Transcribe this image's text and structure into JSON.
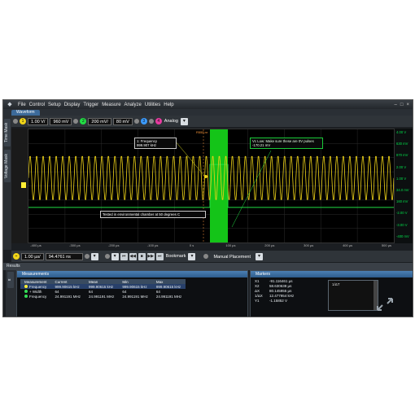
{
  "menu": [
    "File",
    "Control",
    "Setup",
    "Display",
    "Trigger",
    "Measure",
    "Analyze",
    "Utilities",
    "Help"
  ],
  "window_buttons": [
    "–",
    "□",
    "×"
  ],
  "tab_label": "Waveform",
  "side_tabs": [
    "Time Mask",
    "Voltage Mask"
  ],
  "toolbar": {
    "ch1_scale": "1.00 V/",
    "ch1_offset": "960 mV",
    "ch2_scale": "200 mV/",
    "ch2_offset": "80 mV",
    "analog_label": "Analog"
  },
  "volt_labels": [
    "4.00 V",
    "630 mV",
    "870 mV",
    "2.00 V",
    "1.00 V",
    "34.0 mV",
    "160 mV",
    "-2.00 V",
    "-3.00 V",
    "-400 mV"
  ],
  "time_labels": [
    "-400 µs",
    "-300 µs",
    "-200 µs",
    "-100 µs",
    "0 s",
    "100 µs",
    "200 µs",
    "300 µs",
    "400 µs",
    "500 µs"
  ],
  "cursor_label": "R555.nr",
  "annotations": {
    "freq_title": "1: Frequency",
    "freq_value": "999.907 kHz",
    "note_line1": "Vc Low: Make sure these are 0V pulses",
    "note_line2": "-170.21 mV",
    "chamber_note": "Tested in environmental chamber at 50 degrees C"
  },
  "trigger_bar": {
    "timebase": "1.00 µs/",
    "delay": "94.4761 ns",
    "bookmark_label": "Bookmark",
    "placement_label": "Manual Placement"
  },
  "divider_label": "Results",
  "measurements": {
    "title": "Measurements",
    "headers": [
      "Measurement",
      "Current",
      "Mean",
      "Min",
      "Max"
    ],
    "rows": [
      [
        "Frequency",
        "999.90615 kHz",
        "999.90615 kHz",
        "999.90615 kHz",
        "999.90615 kHz"
      ],
      [
        "+ Width",
        "64",
        "64",
        "64",
        "64"
      ],
      [
        "Frequency",
        "24.991191 MHz",
        "24.991191 MHz",
        "24.991191 MHz",
        "24.991191 MHz"
      ]
    ],
    "row_dot_colors": [
      "#ffee33",
      "#33dd55",
      "#33dd55"
    ]
  },
  "markers": {
    "title": "Markers",
    "rows": [
      [
        "X1",
        "-91.116461 µs"
      ],
      [
        "X2",
        "58.630638 µs"
      ],
      [
        "ΔX",
        "80.145955 µs"
      ],
      [
        "1/ΔX",
        "12.477954 kHz"
      ],
      [
        "Y1",
        "-1.15852 V"
      ]
    ],
    "list_item": "1/ΔT"
  },
  "chart_data": {
    "type": "line",
    "series": [
      {
        "color": "#f0d418",
        "cycles": 56,
        "amplitude_fraction": 0.2
      },
      {
        "color": "#22dd44",
        "level_fraction_high": 0.31,
        "level_fraction_low": 0.69
      }
    ]
  }
}
